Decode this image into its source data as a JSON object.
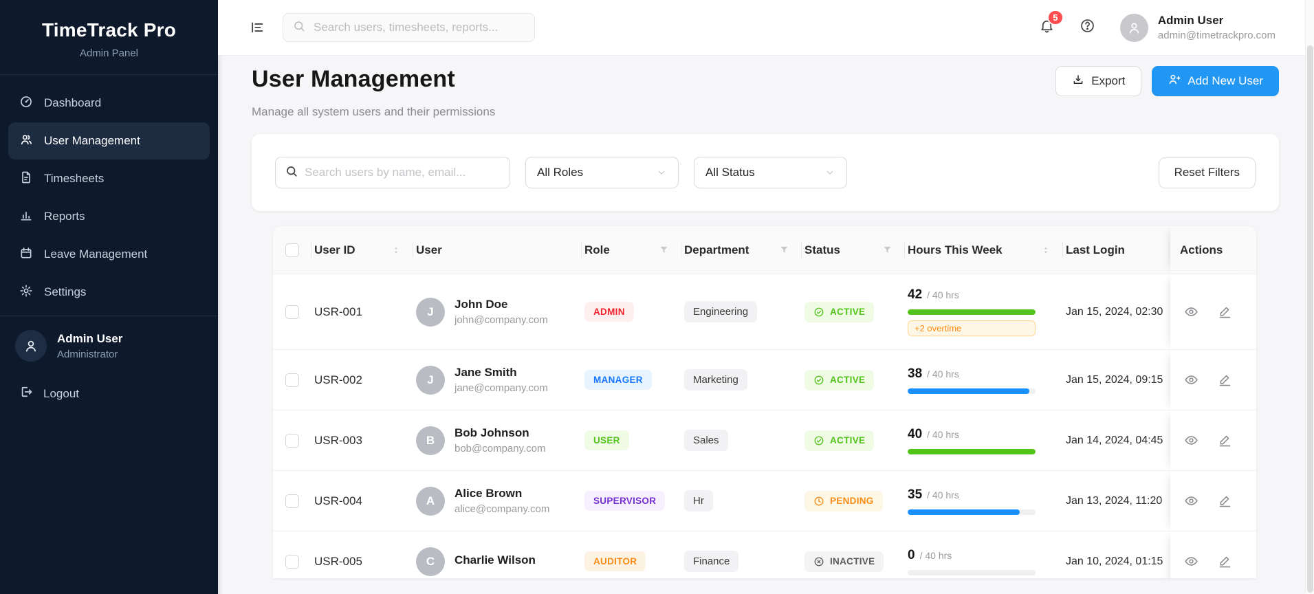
{
  "colors": {
    "accent": "#2196f3",
    "notification": "#ff4d4f",
    "sidebar_bg": "#0e1a2b"
  },
  "icons": {
    "menu-fold-icon": "collapse sidebar",
    "search-icon": "magnifier",
    "bell-icon": "notifications",
    "help-icon": "question circle",
    "download-icon": "export",
    "user-plus-icon": "add user",
    "funnel-icon": "column filter",
    "sort-icon": "column sorter",
    "eye-icon": "view",
    "pencil-icon": "edit",
    "check-circle-icon": "active status",
    "clock-icon": "pending status",
    "x-circle-icon": "inactive status"
  },
  "sidebar": {
    "title": "TimeTrack Pro",
    "subtitle": "Admin Panel",
    "items": [
      {
        "label": "Dashboard",
        "icon": "dashboard-icon",
        "active": false
      },
      {
        "label": "User Management",
        "icon": "users-icon",
        "active": true
      },
      {
        "label": "Timesheets",
        "icon": "document-icon",
        "active": false
      },
      {
        "label": "Reports",
        "icon": "bar-chart-icon",
        "active": false
      },
      {
        "label": "Leave Management",
        "icon": "calendar-icon",
        "active": false
      },
      {
        "label": "Settings",
        "icon": "gear-icon",
        "active": false
      }
    ],
    "user": {
      "name": "Admin User",
      "role": "Administrator"
    },
    "logout_label": "Logout"
  },
  "header": {
    "search_placeholder": "Search users, timesheets, reports...",
    "notification_count": "5",
    "user": {
      "name": "Admin User",
      "email": "admin@timetrackpro.com"
    }
  },
  "page": {
    "title": "User Management",
    "subtitle": "Manage all system users and their permissions",
    "export_label": "Export",
    "add_user_label": "Add New User"
  },
  "filters": {
    "search_placeholder": "Search users by name, email...",
    "role_filter": "All Roles",
    "status_filter": "All Status",
    "reset_label": "Reset Filters"
  },
  "table": {
    "columns": [
      "User ID",
      "User",
      "Role",
      "Department",
      "Status",
      "Hours This Week",
      "Last Login",
      "Actions"
    ],
    "rows": [
      {
        "id": "USR-001",
        "initial": "J",
        "name": "John Doe",
        "email": "john@company.com",
        "role": "ADMIN",
        "role_fg": "#f5222d",
        "role_bg": "#fdf0ef",
        "department": "Engineering",
        "status": "ACTIVE",
        "status_fg": "#52c41a",
        "status_bg": "#f0fbe6",
        "status_icon": "check",
        "hours": "42",
        "hours_suffix": "/ 40 hrs",
        "progress": 100,
        "bar_color": "#52c41a",
        "overtime": "+2 overtime",
        "last_login": "Jan 15, 2024, 02:30"
      },
      {
        "id": "USR-002",
        "initial": "J",
        "name": "Jane Smith",
        "email": "jane@company.com",
        "role": "MANAGER",
        "role_fg": "#1677ff",
        "role_bg": "#e8f4ff",
        "department": "Marketing",
        "status": "ACTIVE",
        "status_fg": "#52c41a",
        "status_bg": "#f0fbe6",
        "status_icon": "check",
        "hours": "38",
        "hours_suffix": "/ 40 hrs",
        "progress": 95,
        "bar_color": "#1890ff",
        "overtime": null,
        "last_login": "Jan 15, 2024, 09:15"
      },
      {
        "id": "USR-003",
        "initial": "B",
        "name": "Bob Johnson",
        "email": "bob@company.com",
        "role": "USER",
        "role_fg": "#52c41a",
        "role_bg": "#f0fbe6",
        "department": "Sales",
        "status": "ACTIVE",
        "status_fg": "#52c41a",
        "status_bg": "#f0fbe6",
        "status_icon": "check",
        "hours": "40",
        "hours_suffix": "/ 40 hrs",
        "progress": 100,
        "bar_color": "#52c41a",
        "overtime": null,
        "last_login": "Jan 14, 2024, 04:45"
      },
      {
        "id": "USR-004",
        "initial": "A",
        "name": "Alice Brown",
        "email": "alice@company.com",
        "role": "SUPERVISOR",
        "role_fg": "#722ed1",
        "role_bg": "#f7f0fe",
        "department": "Hr",
        "status": "PENDING",
        "status_fg": "#fa8c16",
        "status_bg": "#fdf7e6",
        "status_icon": "clock",
        "hours": "35",
        "hours_suffix": "/ 40 hrs",
        "progress": 87.5,
        "bar_color": "#1890ff",
        "overtime": null,
        "last_login": "Jan 13, 2024, 11:20"
      },
      {
        "id": "USR-005",
        "initial": "C",
        "name": "Charlie Wilson",
        "email": "",
        "role": "AUDITOR",
        "role_fg": "#fa8c16",
        "role_bg": "#fdf3e3",
        "department": "Finance",
        "status": "INACTIVE",
        "status_fg": "#595959",
        "status_bg": "#f4f4f5",
        "status_icon": "x",
        "hours": "0",
        "hours_suffix": "/ 40 hrs",
        "progress": 0,
        "bar_color": "transparent",
        "overtime": null,
        "last_login": "Jan 10, 2024, 01:15"
      }
    ]
  }
}
